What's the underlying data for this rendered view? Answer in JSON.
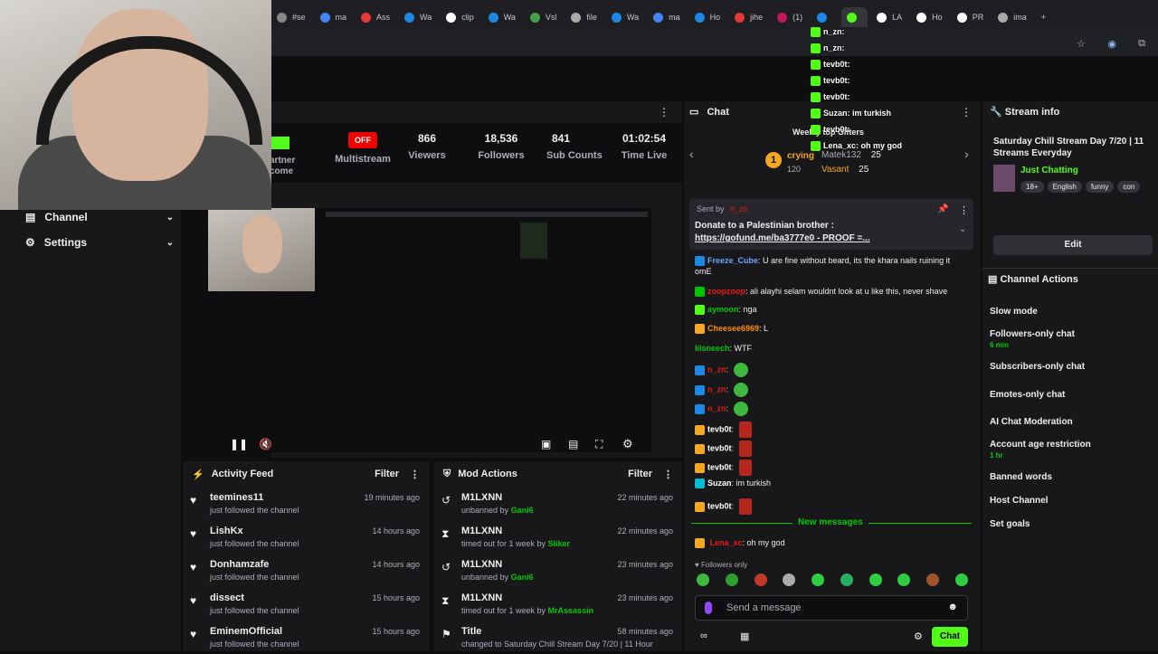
{
  "browser": {
    "tabs": [
      {
        "label": "#se",
        "color": "#888"
      },
      {
        "label": "ma",
        "color": "#4285f4"
      },
      {
        "label": "Ass",
        "color": "#e53935"
      },
      {
        "label": "Wa",
        "color": "#1e88e5"
      },
      {
        "label": "clip",
        "color": "#fff"
      },
      {
        "label": "Wa",
        "color": "#1e88e5"
      },
      {
        "label": "Vsl",
        "color": "#43a047"
      },
      {
        "label": "file",
        "color": "#aaa"
      },
      {
        "label": "Wa",
        "color": "#1e88e5"
      },
      {
        "label": "ma",
        "color": "#4285f4"
      },
      {
        "label": "Ho",
        "color": "#1e88e5"
      },
      {
        "label": "jihe",
        "color": "#e53935"
      },
      {
        "label": "(1)",
        "color": "#c2185b"
      },
      {
        "label": "",
        "color": "#1e88e5"
      },
      {
        "label": "",
        "color": "#53fc18"
      },
      {
        "label": "LA",
        "color": "#fff"
      },
      {
        "label": "Ho",
        "color": "#fff"
      },
      {
        "label": "PR",
        "color": "#fff"
      },
      {
        "label": "ima",
        "color": "#aaa"
      }
    ],
    "new_tab": "+"
  },
  "nav": {
    "channel": "Channel",
    "settings": "Settings"
  },
  "stats": {
    "partner": "artner\ncome",
    "multistream_badge": "OFF",
    "multistream": "Multistream",
    "viewers_n": "866",
    "viewers": "Viewers",
    "followers_n": "18,536",
    "followers": "Followers",
    "subs_n": "841",
    "subs": "Sub Counts",
    "time_n": "01:02:54",
    "time": "Time Live"
  },
  "activity": {
    "title": "Activity Feed",
    "filter": "Filter",
    "rows": [
      {
        "name": "teemines11",
        "sub": "just followed the channel",
        "time": "19 minutes ago"
      },
      {
        "name": "LishKx",
        "sub": "just followed the channel",
        "time": "14 hours ago"
      },
      {
        "name": "Donhamzafe",
        "sub": "just followed the channel",
        "time": "14 hours ago"
      },
      {
        "name": "dissect",
        "sub": "just followed the channel",
        "time": "15 hours ago"
      },
      {
        "name": "EminemOfficial",
        "sub": "just followed the channel",
        "time": "15 hours ago"
      }
    ]
  },
  "mod": {
    "title": "Mod Actions",
    "filter": "Filter",
    "rows": [
      {
        "name": "M1LXNN",
        "pre": "unbanned by ",
        "by": "Gani6",
        "time": "22 minutes ago",
        "icon": "undo"
      },
      {
        "name": "M1LXNN",
        "pre": "timed out for 1 week by ",
        "by": "Sliker",
        "time": "22 minutes ago",
        "icon": "hourglass"
      },
      {
        "name": "M1LXNN",
        "pre": "unbanned by ",
        "by": "Gani6",
        "time": "23 minutes ago",
        "icon": "undo"
      },
      {
        "name": "M1LXNN",
        "pre": "timed out for 1 week by ",
        "by": "MrAssassin",
        "time": "23 minutes ago",
        "icon": "hourglass"
      },
      {
        "name": "Title",
        "pre": "changed to Saturday Chill Stream Day 7/20 | 11 Hour",
        "by": "",
        "time": "58 minutes ago",
        "icon": "sign"
      }
    ]
  },
  "chat": {
    "title": "Chat",
    "top_gifters": "Weekly top Gifters",
    "gifters": [
      {
        "name": "crying",
        "count": "120"
      },
      {
        "name": "Matek132",
        "count": "25"
      },
      {
        "name": "Vasant",
        "count": "25"
      }
    ],
    "pinned": {
      "sent_by": "Sent by",
      "user": "n_zn",
      "text": "Donate to a Palestinian brother :",
      "link": "https://gofund.me/ba3777e0 - PROOF =..."
    },
    "messages": [
      {
        "user": "Freeze_Cube",
        "color": "#6ea6ff",
        "text": ": U are fine without beard, its the khara nails ruining it omE"
      },
      {
        "user": "zoopzoop",
        "color": "#e91916",
        "text": ": ali alayhi selam wouldnt look at u like this, never shave"
      },
      {
        "user": "aymoon",
        "color": "#00c800",
        "text": ": nga"
      },
      {
        "user": "Cheesee6969",
        "color": "#ff8c00",
        "text": ": L"
      },
      {
        "user": "lilsneech",
        "color": "#00c800",
        "text": ": WTF"
      },
      {
        "user": "n_zn",
        "color": "#e91916",
        "text": ":"
      },
      {
        "user": "n_zn",
        "color": "#e91916",
        "text": ":"
      },
      {
        "user": "n_zn",
        "color": "#e91916",
        "text": ":"
      },
      {
        "user": "tevb0t",
        "color": "#ffffff",
        "text": ":"
      },
      {
        "user": "tevb0t",
        "color": "#ffffff",
        "text": ":"
      },
      {
        "user": "tevb0t",
        "color": "#ffffff",
        "text": ":"
      },
      {
        "user": "Suzan",
        "color": "#ffffff",
        "text": ": im turkish"
      },
      {
        "user": "tevb0t",
        "color": "#ffffff",
        "text": ":"
      }
    ],
    "new_messages": "New messages",
    "after": {
      "user": "Lena_xc",
      "text": ": oh my god"
    },
    "followers_only": "Followers only",
    "placeholder": "Send a message",
    "send": "Chat"
  },
  "overlay": [
    {
      "user": "n_zn",
      "text": ":"
    },
    {
      "user": "n_zn",
      "text": ":"
    },
    {
      "user": "tevb0t",
      "text": ":"
    },
    {
      "user": "tevb0t",
      "text": ":"
    },
    {
      "user": "tevb0t",
      "text": ":"
    },
    {
      "user": "Suzan",
      "text": ": im turkish"
    },
    {
      "user": "tevb0t",
      "text": ":"
    },
    {
      "user": "Lena_xc",
      "text": ": oh my god"
    }
  ],
  "stream_info": {
    "title": "Stream info",
    "stream_title": "Saturday Chill Stream Day 7/20 | 11 Streams Everyday",
    "category": "Just Chatting",
    "tags": [
      "18+",
      "English",
      "funny",
      "con"
    ],
    "edit": "Edit"
  },
  "channel_actions": {
    "title": "Channel Actions",
    "items": [
      {
        "label": "Slow mode",
        "sub": ""
      },
      {
        "label": "Followers-only chat",
        "sub": "6 min"
      },
      {
        "label": "Subscribers-only chat",
        "sub": ""
      },
      {
        "label": "Emotes-only chat",
        "sub": ""
      },
      {
        "label": "AI Chat Moderation",
        "sub": ""
      },
      {
        "label": "Account age restriction",
        "sub": "1 hr"
      },
      {
        "label": "Banned words",
        "sub": ""
      },
      {
        "label": "Host Channel",
        "sub": ""
      },
      {
        "label": "Set goals",
        "sub": ""
      }
    ]
  },
  "colors": {
    "brand": "#53fc18",
    "live": "#eb0400"
  }
}
